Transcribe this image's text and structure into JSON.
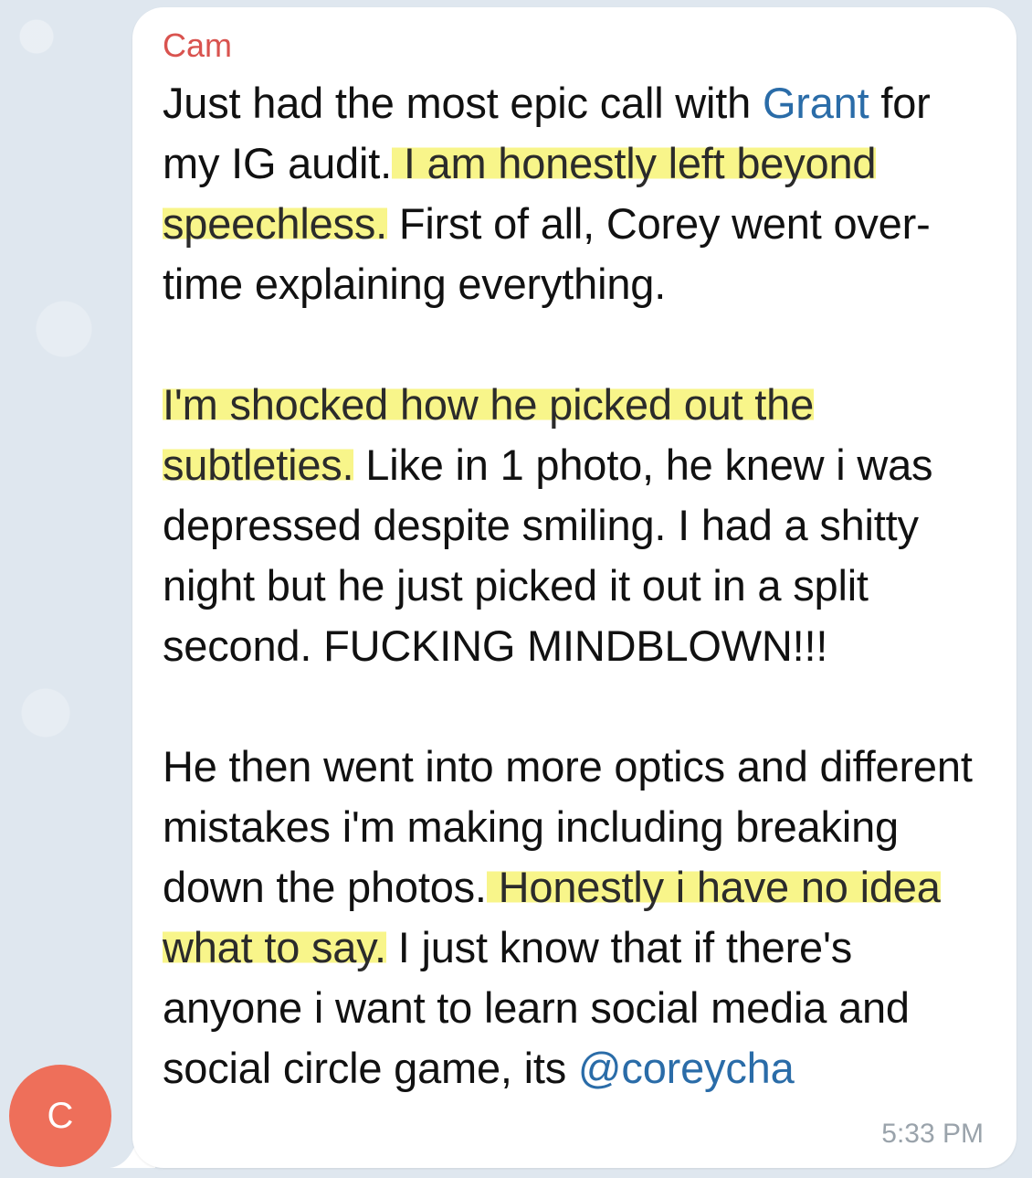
{
  "message": {
    "sender": "Cam",
    "avatar_letter": "C",
    "time": "5:33 PM",
    "p1": {
      "t1": "Just had the most epic call with ",
      "mention": "Grant",
      "t2": " for my IG audit.",
      "hl1": " I am honestly left beyond speechless.",
      "t3": " First of all, Corey went over-time explaining everything."
    },
    "p2": {
      "hl1": "I'm shocked how he picked out the subtleties.",
      "t1": " Like in 1 photo, he knew i was depressed despite smiling. I had a shitty night but he just picked it out in a split second. FUCKING MINDBLOWN!!!"
    },
    "p3": {
      "t1": "He then went into more optics and different mistakes i'm making including breaking down the photos.",
      "hl1": " Honestly i have no idea what to say.",
      "t2": " I just know that if there's anyone i want to learn social media and social circle game, its ",
      "mention": "@coreycha"
    }
  },
  "colors": {
    "sender": "#d9534f",
    "link": "#2a6ca8",
    "highlight": "#f8f58a",
    "avatar": "#ee6f5a"
  }
}
